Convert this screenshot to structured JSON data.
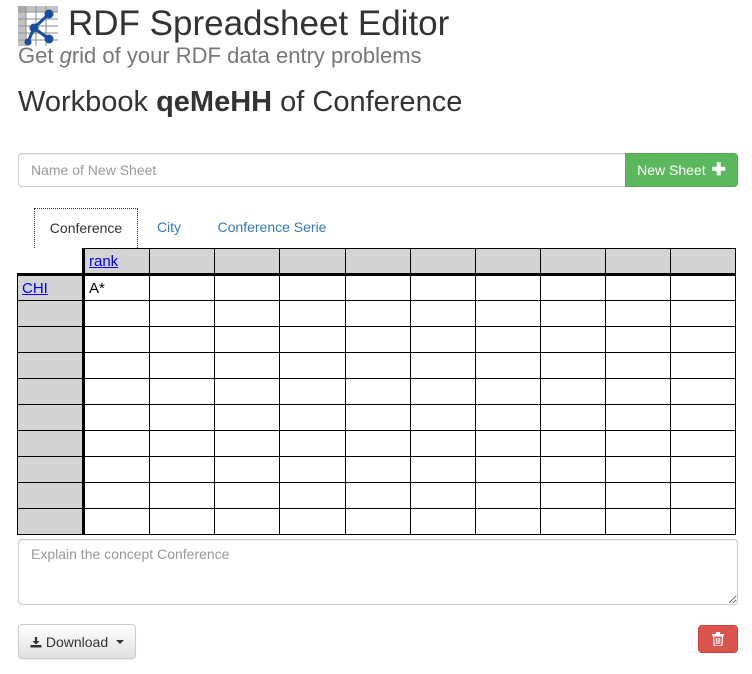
{
  "app": {
    "title": "RDF Spreadsheet Editor",
    "tagline_pre": "Get ",
    "tagline_g": "g",
    "tagline_post": "rid of your RDF data entry problems"
  },
  "workbook": {
    "prefix": "Workbook ",
    "id": "qeMeHH",
    "suffix": " of Conference"
  },
  "new_sheet": {
    "placeholder": "Name of New Sheet",
    "button_label": "New Sheet",
    "button_icon": "plus-icon",
    "button_color": "#5cb85c"
  },
  "tabs": [
    {
      "label": "Conference",
      "active": true
    },
    {
      "label": "City",
      "active": false
    },
    {
      "label": "Conference Serie",
      "active": false
    }
  ],
  "grid": {
    "columns": [
      "rank",
      "",
      "",
      "",
      "",
      "",
      "",
      "",
      "",
      ""
    ],
    "rows": [
      {
        "header": "CHI",
        "cells": [
          "A*",
          "",
          "",
          "",
          "",
          "",
          "",
          "",
          "",
          ""
        ]
      },
      {
        "header": "",
        "cells": [
          "",
          "",
          "",
          "",
          "",
          "",
          "",
          "",
          "",
          ""
        ]
      },
      {
        "header": "",
        "cells": [
          "",
          "",
          "",
          "",
          "",
          "",
          "",
          "",
          "",
          ""
        ]
      },
      {
        "header": "",
        "cells": [
          "",
          "",
          "",
          "",
          "",
          "",
          "",
          "",
          "",
          ""
        ]
      },
      {
        "header": "",
        "cells": [
          "",
          "",
          "",
          "",
          "",
          "",
          "",
          "",
          "",
          ""
        ]
      },
      {
        "header": "",
        "cells": [
          "",
          "",
          "",
          "",
          "",
          "",
          "",
          "",
          "",
          ""
        ]
      },
      {
        "header": "",
        "cells": [
          "",
          "",
          "",
          "",
          "",
          "",
          "",
          "",
          "",
          ""
        ]
      },
      {
        "header": "",
        "cells": [
          "",
          "",
          "",
          "",
          "",
          "",
          "",
          "",
          "",
          ""
        ]
      },
      {
        "header": "",
        "cells": [
          "",
          "",
          "",
          "",
          "",
          "",
          "",
          "",
          "",
          ""
        ]
      },
      {
        "header": "",
        "cells": [
          "",
          "",
          "",
          "",
          "",
          "",
          "",
          "",
          "",
          ""
        ]
      }
    ],
    "header_bg": "#d3d3d3"
  },
  "concept": {
    "placeholder": "Explain the concept Conference"
  },
  "footer": {
    "download_label": "Download",
    "download_icon": "download-icon",
    "delete_icon": "trash-icon",
    "delete_color": "#d9534f"
  }
}
